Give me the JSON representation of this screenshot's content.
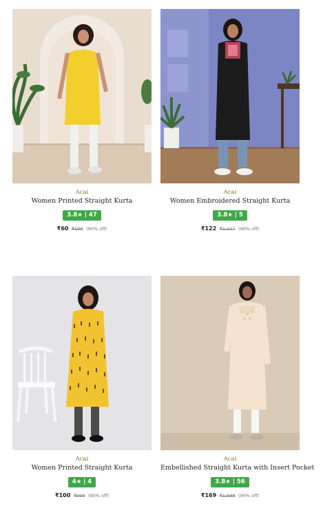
{
  "products": [
    {
      "brand": "Acai",
      "title": "Women Printed Straight Kurta",
      "rating": "3.8★ | 47",
      "price": "₹60",
      "mrp": "₹599",
      "discount": "(90% off)",
      "kurta_color": "#f2cf2c"
    },
    {
      "brand": "Acai",
      "title": "Women Embroidered Straight Kurta",
      "rating": "3.8★ | 5",
      "price": "₹122",
      "mrp": "₹1,217",
      "discount": "(90% off)",
      "kurta_color": "#1b1b1b"
    },
    {
      "brand": "Acai",
      "title": "Women Printed Straight Kurta",
      "rating": "4★ | 4",
      "price": "₹100",
      "mrp": "₹999",
      "discount": "(90% off)",
      "kurta_color": "#f2c330"
    },
    {
      "brand": "Acai",
      "title": "Embellished Straight Kurta with Insert Pocket",
      "rating": "3.8★ | 56",
      "price": "₹169",
      "mrp": "₹1,688",
      "discount": "(90% off)",
      "kurta_color": "#f4e4cf"
    }
  ]
}
